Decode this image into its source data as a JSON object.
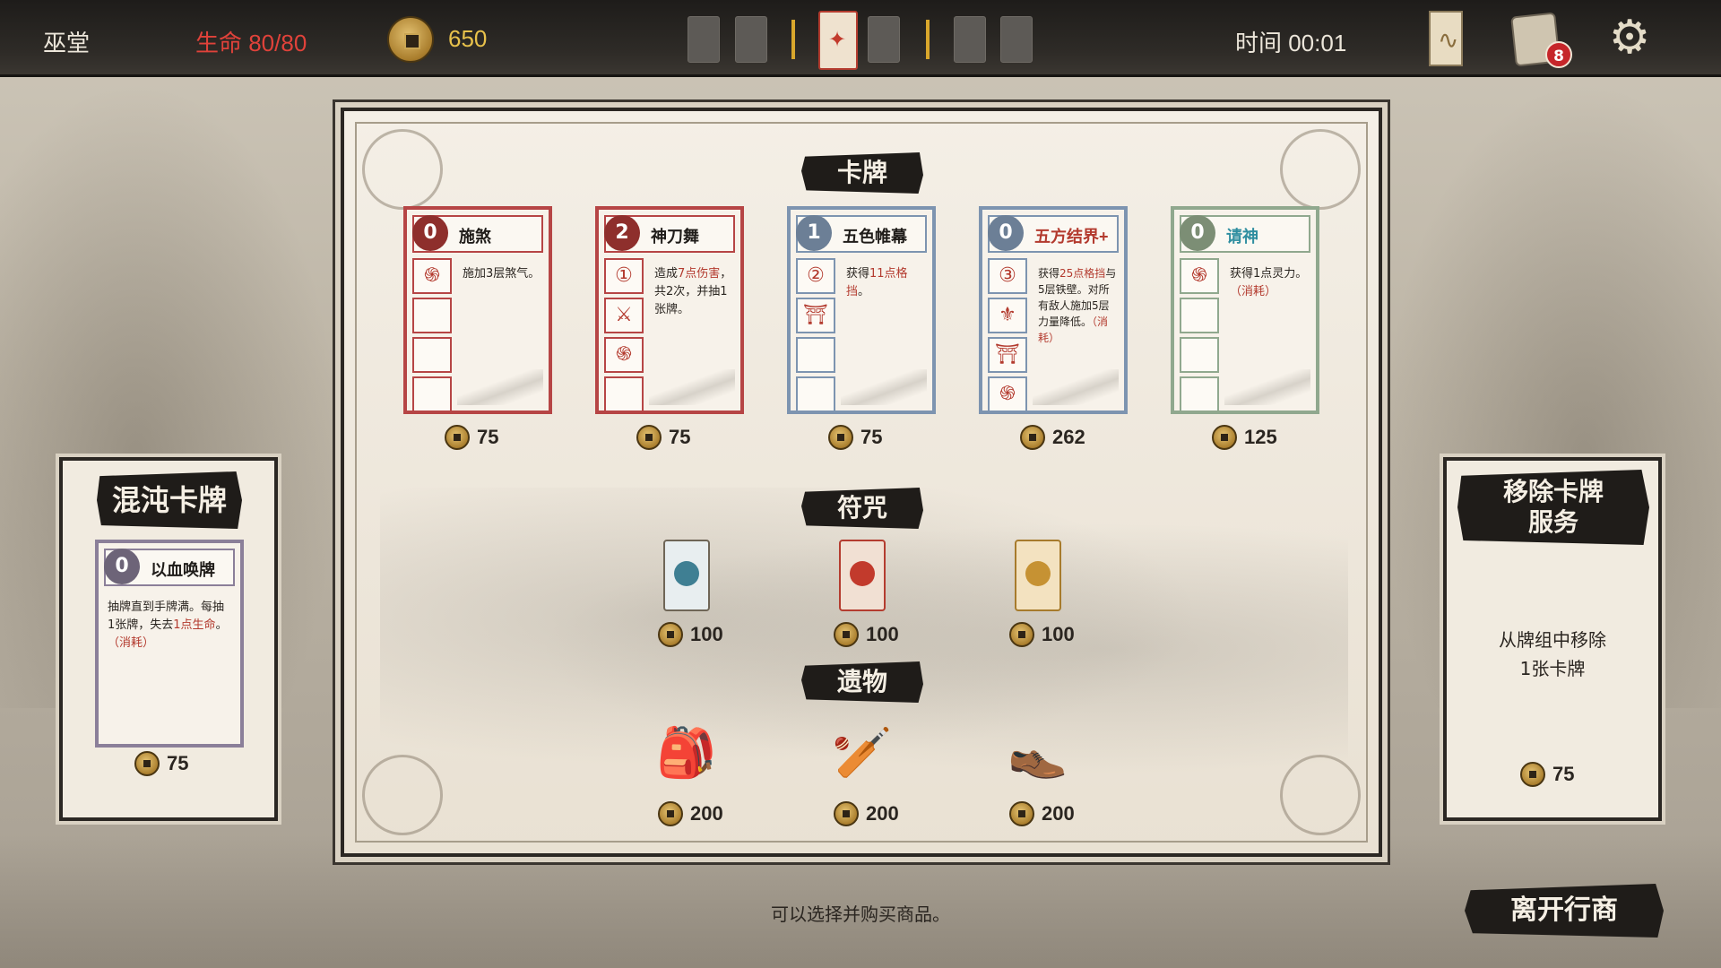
{
  "topbar": {
    "character": "巫堂",
    "hp_label": "生命 80/80",
    "gold": "650",
    "timer": "时间 00:01",
    "deck_count": "8",
    "icons": [
      "coin-icon",
      "card-slot",
      "map-icon",
      "deck-icon",
      "gear-icon"
    ]
  },
  "sections": {
    "cards": "卡牌",
    "talismans": "符咒",
    "relics": "遗物"
  },
  "cards": [
    {
      "cost": "0",
      "name": "施煞",
      "desc": "施加3层煞气。",
      "price": "75",
      "color": "red"
    },
    {
      "cost": "2",
      "name": "神刀舞",
      "desc_pre": "造成",
      "desc_hl": "7点伤害",
      "desc_post": "，共2次，并抽1张牌。",
      "price": "75",
      "color": "red"
    },
    {
      "cost": "1",
      "name": "五色帷幕",
      "desc_pre": "获得",
      "desc_hl": "11点格挡",
      "desc_post": "。",
      "price": "75",
      "color": "blue"
    },
    {
      "cost": "0",
      "name": "五方结界+",
      "desc_pre": "获得",
      "desc_hl": "25点格挡",
      "desc_post": "与5层铁壁。对所有敌人施加5层力量降低。",
      "desc_tag": "（消耗）",
      "price": "262",
      "color": "blue"
    },
    {
      "cost": "0",
      "name": "请神",
      "desc_pre": "获得1点灵力。",
      "desc_tag": "（消耗）",
      "price": "125",
      "color": "green"
    }
  ],
  "talismans": [
    {
      "price": "100",
      "icon": "water-talisman-icon",
      "color": "#e8eef0"
    },
    {
      "price": "100",
      "icon": "fire-talisman-icon",
      "color": "#f1e0d3"
    },
    {
      "price": "100",
      "icon": "earth-talisman-icon",
      "color": "#f3e2c0"
    }
  ],
  "relics": [
    {
      "price": "200",
      "icon": "pouch-icon",
      "glyph": "🎒"
    },
    {
      "price": "200",
      "icon": "mace-icon",
      "glyph": "🏏"
    },
    {
      "price": "200",
      "icon": "shoes-icon",
      "glyph": "👞"
    }
  ],
  "chaos_card": {
    "title": "混沌卡牌",
    "cost": "0",
    "name": "以血唤牌",
    "desc_pre": "抽牌直到手牌满。每抽1张牌，失去",
    "desc_hl": "1点生命",
    "desc_post": "。",
    "desc_tag": "（消耗）",
    "price": "75"
  },
  "remove_service": {
    "title_line1": "移除卡牌",
    "title_line2": "服务",
    "desc_line1": "从牌组中移除",
    "desc_line2": "1张卡牌",
    "price": "75"
  },
  "hint": "可以选择并购买商品。",
  "leave_button": "离开行商"
}
